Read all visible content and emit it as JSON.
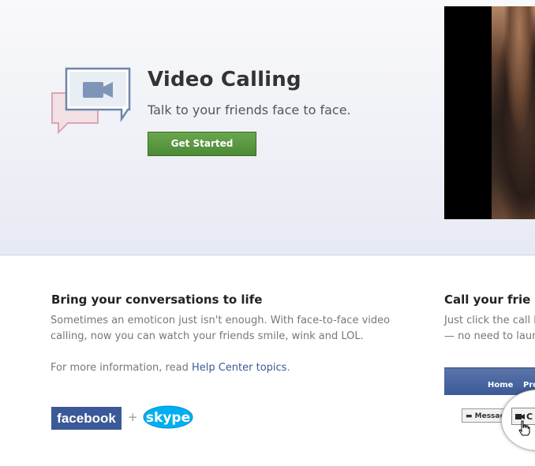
{
  "hero": {
    "title": "Video Calling",
    "subtitle": "Talk to your friends face to face.",
    "cta_label": "Get Started",
    "icon": "chat-bubbles-video-camera-icon"
  },
  "section_left": {
    "title": "Bring your conversations to life",
    "body": "Sometimes an emoticon just isn't enough. With face-to-face video calling, now you can watch your friends smile, wink and LOL.",
    "more_info_prefix": "For more information, read ",
    "more_info_link": "Help Center topics",
    "more_info_suffix": "."
  },
  "section_right": {
    "title": "Call your frie",
    "body_line1": "Just click the call b",
    "body_line2": "— no need to laun"
  },
  "logos": {
    "facebook": "facebook",
    "plus": "+",
    "skype": "skype"
  },
  "preview": {
    "nav_home": "Home",
    "nav_profile": "Pro",
    "message_btn": "Messag",
    "call_btn": "C"
  },
  "colors": {
    "facebook_blue": "#3b5998",
    "cta_green": "#5a9a40",
    "skype_blue": "#00aff0"
  }
}
